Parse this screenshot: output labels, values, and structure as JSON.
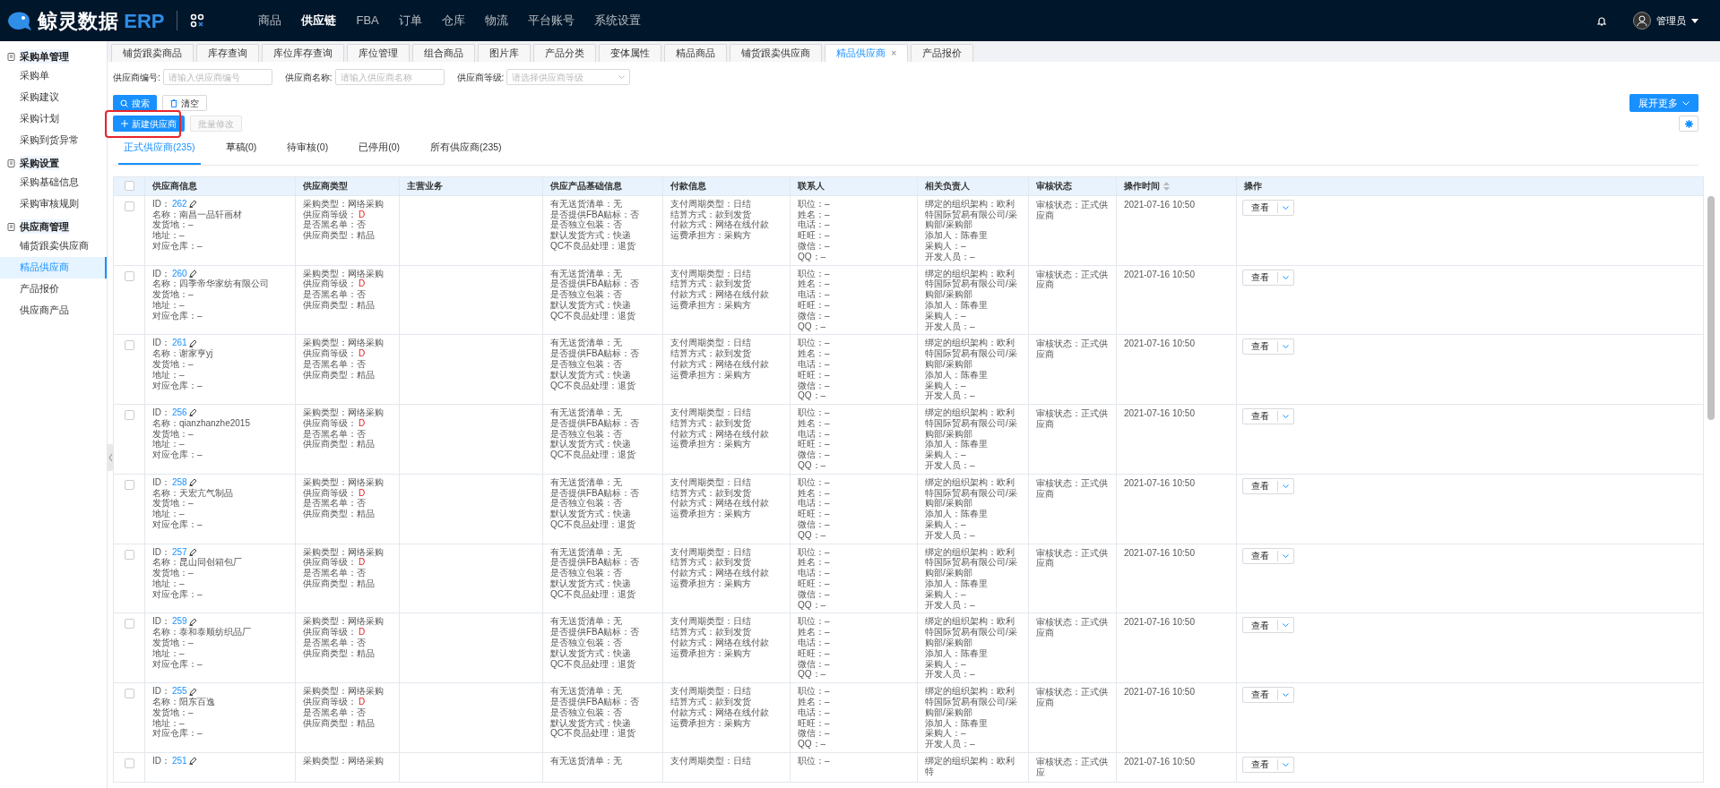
{
  "brand": {
    "name": "鲸灵数据",
    "suffix": "ERP"
  },
  "nav": [
    {
      "label": "商品",
      "selected": false
    },
    {
      "label": "供应链",
      "selected": true
    },
    {
      "label": "FBA",
      "selected": false
    },
    {
      "label": "订单",
      "selected": false
    },
    {
      "label": "仓库",
      "selected": false
    },
    {
      "label": "物流",
      "selected": false
    },
    {
      "label": "平台账号",
      "selected": false
    },
    {
      "label": "系统设置",
      "selected": false
    }
  ],
  "user": {
    "name": "管理员"
  },
  "sidebar": [
    {
      "label": "采购单管理",
      "children": [
        {
          "label": "采购单",
          "selected": false
        },
        {
          "label": "采购建议",
          "selected": false
        },
        {
          "label": "采购计划",
          "selected": false
        },
        {
          "label": "采购到货异常",
          "selected": false
        }
      ]
    },
    {
      "label": "采购设置",
      "children": [
        {
          "label": "采购基础信息",
          "selected": false
        },
        {
          "label": "采购审核规则",
          "selected": false
        }
      ]
    },
    {
      "label": "供应商管理",
      "children": [
        {
          "label": "铺货跟卖供应商",
          "selected": false
        },
        {
          "label": "精品供应商",
          "selected": true
        },
        {
          "label": "产品报价",
          "selected": false
        },
        {
          "label": "供应商产品",
          "selected": false
        }
      ]
    }
  ],
  "tabs": [
    {
      "label": "铺货跟卖商品",
      "selected": false
    },
    {
      "label": "库存查询",
      "selected": false
    },
    {
      "label": "库位库存查询",
      "selected": false
    },
    {
      "label": "库位管理",
      "selected": false
    },
    {
      "label": "组合商品",
      "selected": false
    },
    {
      "label": "图片库",
      "selected": false
    },
    {
      "label": "产品分类",
      "selected": false
    },
    {
      "label": "变体属性",
      "selected": false
    },
    {
      "label": "精品商品",
      "selected": false
    },
    {
      "label": "铺货跟卖供应商",
      "selected": false
    },
    {
      "label": "精品供应商",
      "selected": true,
      "close": "×"
    },
    {
      "label": "产品报价",
      "selected": false
    }
  ],
  "filters": [
    {
      "label": "供应商编号:",
      "placeholder": "请输入供应商编号",
      "kind": "input"
    },
    {
      "label": "供应商名称:",
      "placeholder": "请输入供应商名称",
      "kind": "input"
    },
    {
      "label": "供应商等级:",
      "placeholder": "请选择供应商等级",
      "kind": "select"
    }
  ],
  "search_button": "搜索",
  "clear_button": "清空",
  "expand_button": "展开更多",
  "new_button": "新建供应商",
  "batch_button": {
    "label": "批量修改",
    "disabled": true
  },
  "status_tabs": [
    {
      "label": "正式供应商(235)",
      "selected": true
    },
    {
      "label": "草稿(0)",
      "selected": false
    },
    {
      "label": "待审核(0)",
      "selected": false
    },
    {
      "label": "已停用(0)",
      "selected": false
    },
    {
      "label": "所有供应商(235)",
      "selected": false
    }
  ],
  "table": {
    "select_all_checked": false,
    "columns": [
      "供应商信息",
      "供应商类型",
      "主营业务",
      "供应产品基础信息",
      "付款信息",
      "联系人",
      "相关负责人",
      "审核状态",
      "操作时间",
      "操作"
    ],
    "rows": [
      {
        "checked": false,
        "supplier": [
          {
            "label": "ID：",
            "value": "262",
            "kind": "id"
          },
          "名称：南昌一品轩画材",
          "发货地：–",
          "地址：–",
          "对应仓库：–"
        ],
        "type": [
          "采购类型：网络采购",
          {
            "label": "供应商等级：",
            "value": "D",
            "kind": "grade"
          },
          "是否黑名单：否",
          "供应商类型：精品"
        ],
        "product": [
          "有无送货清单：无",
          "是否提供FBA贴标：否",
          "是否独立包装：否",
          "默认发货方式：快递",
          "QC不良品处理：退货"
        ],
        "payment": [
          "支付周期类型：日结",
          "结算方式：款到发货",
          "付款方式：网络在线付款",
          "运费承担方：采购方"
        ],
        "contact": [
          "职位：–",
          "姓名：–",
          "电话：–",
          "旺旺：–",
          "微信：–",
          "QQ：–"
        ],
        "owner": [
          "绑定的组织架构：欧利特国际贸易有限公司/采购部/采购部",
          "添加人：陈春里",
          "采购人：–",
          "开发人员：–"
        ],
        "review": "审核状态：正式供应商",
        "time": "2021-07-16 10:50",
        "action": "查看"
      },
      {
        "checked": false,
        "supplier": [
          {
            "label": "ID：",
            "value": "260",
            "kind": "id"
          },
          "名称：四季帝华家纺有限公司",
          "发货地：–",
          "地址：–",
          "对应仓库：–"
        ],
        "type": [
          "采购类型：网络采购",
          {
            "label": "供应商等级：",
            "value": "D",
            "kind": "grade"
          },
          "是否黑名单：否",
          "供应商类型：精品"
        ],
        "product": [
          "有无送货清单：无",
          "是否提供FBA贴标：否",
          "是否独立包装：否",
          "默认发货方式：快递",
          "QC不良品处理：退货"
        ],
        "payment": [
          "支付周期类型：日结",
          "结算方式：款到发货",
          "付款方式：网络在线付款",
          "运费承担方：采购方"
        ],
        "contact": [
          "职位：–",
          "姓名：–",
          "电话：–",
          "旺旺：–",
          "微信：–",
          "QQ：–"
        ],
        "owner": [
          "绑定的组织架构：欧利特国际贸易有限公司/采购部/采购部",
          "添加人：陈春里",
          "采购人：–",
          "开发人员：–"
        ],
        "review": "审核状态：正式供应商",
        "time": "2021-07-16 10:50",
        "action": "查看"
      },
      {
        "checked": false,
        "supplier": [
          {
            "label": "ID：",
            "value": "261",
            "kind": "id"
          },
          "名称：谢家亨yj",
          "发货地：–",
          "地址：–",
          "对应仓库：–"
        ],
        "type": [
          "采购类型：网络采购",
          {
            "label": "供应商等级：",
            "value": "D",
            "kind": "grade"
          },
          "是否黑名单：否",
          "供应商类型：精品"
        ],
        "product": [
          "有无送货清单：无",
          "是否提供FBA贴标：否",
          "是否独立包装：否",
          "默认发货方式：快递",
          "QC不良品处理：退货"
        ],
        "payment": [
          "支付周期类型：日结",
          "结算方式：款到发货",
          "付款方式：网络在线付款",
          "运费承担方：采购方"
        ],
        "contact": [
          "职位：–",
          "姓名：–",
          "电话：–",
          "旺旺：–",
          "微信：–",
          "QQ：–"
        ],
        "owner": [
          "绑定的组织架构：欧利特国际贸易有限公司/采购部/采购部",
          "添加人：陈春里",
          "采购人：–",
          "开发人员：–"
        ],
        "review": "审核状态：正式供应商",
        "time": "2021-07-16 10:50",
        "action": "查看"
      },
      {
        "checked": false,
        "supplier": [
          {
            "label": "ID：",
            "value": "256",
            "kind": "id"
          },
          "名称：qianzhanzhe2015",
          "发货地：–",
          "地址：–",
          "对应仓库：–"
        ],
        "type": [
          "采购类型：网络采购",
          {
            "label": "供应商等级：",
            "value": "D",
            "kind": "grade"
          },
          "是否黑名单：否",
          "供应商类型：精品"
        ],
        "product": [
          "有无送货清单：无",
          "是否提供FBA贴标：否",
          "是否独立包装：否",
          "默认发货方式：快递",
          "QC不良品处理：退货"
        ],
        "payment": [
          "支付周期类型：日结",
          "结算方式：款到发货",
          "付款方式：网络在线付款",
          "运费承担方：采购方"
        ],
        "contact": [
          "职位：–",
          "姓名：–",
          "电话：–",
          "旺旺：–",
          "微信：–",
          "QQ：–"
        ],
        "owner": [
          "绑定的组织架构：欧利特国际贸易有限公司/采购部/采购部",
          "添加人：陈春里",
          "采购人：–",
          "开发人员：–"
        ],
        "review": "审核状态：正式供应商",
        "time": "2021-07-16 10:50",
        "action": "查看"
      },
      {
        "checked": false,
        "supplier": [
          {
            "label": "ID：",
            "value": "258",
            "kind": "id"
          },
          "名称：天宏亢气制品",
          "发货地：–",
          "地址：–",
          "对应仓库：–"
        ],
        "type": [
          "采购类型：网络采购",
          {
            "label": "供应商等级：",
            "value": "D",
            "kind": "grade"
          },
          "是否黑名单：否",
          "供应商类型：精品"
        ],
        "product": [
          "有无送货清单：无",
          "是否提供FBA贴标：否",
          "是否独立包装：否",
          "默认发货方式：快递",
          "QC不良品处理：退货"
        ],
        "payment": [
          "支付周期类型：日结",
          "结算方式：款到发货",
          "付款方式：网络在线付款",
          "运费承担方：采购方"
        ],
        "contact": [
          "职位：–",
          "姓名：–",
          "电话：–",
          "旺旺：–",
          "微信：–",
          "QQ：–"
        ],
        "owner": [
          "绑定的组织架构：欧利特国际贸易有限公司/采购部/采购部",
          "添加人：陈春里",
          "采购人：–",
          "开发人员：–"
        ],
        "review": "审核状态：正式供应商",
        "time": "2021-07-16 10:50",
        "action": "查看"
      },
      {
        "checked": false,
        "supplier": [
          {
            "label": "ID：",
            "value": "257",
            "kind": "id"
          },
          "名称：昆山同创箱包厂",
          "发货地：–",
          "地址：–",
          "对应仓库：–"
        ],
        "type": [
          "采购类型：网络采购",
          {
            "label": "供应商等级：",
            "value": "D",
            "kind": "grade"
          },
          "是否黑名单：否",
          "供应商类型：精品"
        ],
        "product": [
          "有无送货清单：无",
          "是否提供FBA贴标：否",
          "是否独立包装：否",
          "默认发货方式：快递",
          "QC不良品处理：退货"
        ],
        "payment": [
          "支付周期类型：日结",
          "结算方式：款到发货",
          "付款方式：网络在线付款",
          "运费承担方：采购方"
        ],
        "contact": [
          "职位：–",
          "姓名：–",
          "电话：–",
          "旺旺：–",
          "微信：–",
          "QQ：–"
        ],
        "owner": [
          "绑定的组织架构：欧利特国际贸易有限公司/采购部/采购部",
          "添加人：陈春里",
          "采购人：–",
          "开发人员：–"
        ],
        "review": "审核状态：正式供应商",
        "time": "2021-07-16 10:50",
        "action": "查看"
      },
      {
        "checked": false,
        "supplier": [
          {
            "label": "ID：",
            "value": "259",
            "kind": "id"
          },
          "名称：泰和泰顺纺织品厂",
          "发货地：–",
          "地址：–",
          "对应仓库：–"
        ],
        "type": [
          "采购类型：网络采购",
          {
            "label": "供应商等级：",
            "value": "D",
            "kind": "grade"
          },
          "是否黑名单：否",
          "供应商类型：精品"
        ],
        "product": [
          "有无送货清单：无",
          "是否提供FBA贴标：否",
          "是否独立包装：否",
          "默认发货方式：快递",
          "QC不良品处理：退货"
        ],
        "payment": [
          "支付周期类型：日结",
          "结算方式：款到发货",
          "付款方式：网络在线付款",
          "运费承担方：采购方"
        ],
        "contact": [
          "职位：–",
          "姓名：–",
          "电话：–",
          "旺旺：–",
          "微信：–",
          "QQ：–"
        ],
        "owner": [
          "绑定的组织架构：欧利特国际贸易有限公司/采购部/采购部",
          "添加人：陈春里",
          "采购人：–",
          "开发人员：–"
        ],
        "review": "审核状态：正式供应商",
        "time": "2021-07-16 10:50",
        "action": "查看"
      },
      {
        "checked": false,
        "supplier": [
          {
            "label": "ID：",
            "value": "255",
            "kind": "id"
          },
          "名称：阳东百逸",
          "发货地：–",
          "地址：–",
          "对应仓库：–"
        ],
        "type": [
          "采购类型：网络采购",
          {
            "label": "供应商等级：",
            "value": "D",
            "kind": "grade"
          },
          "是否黑名单：否",
          "供应商类型：精品"
        ],
        "product": [
          "有无送货清单：无",
          "是否提供FBA贴标：否",
          "是否独立包装：否",
          "默认发货方式：快递",
          "QC不良品处理：退货"
        ],
        "payment": [
          "支付周期类型：日结",
          "结算方式：款到发货",
          "付款方式：网络在线付款",
          "运费承担方：采购方"
        ],
        "contact": [
          "职位：–",
          "姓名：–",
          "电话：–",
          "旺旺：–",
          "微信：–",
          "QQ：–"
        ],
        "owner": [
          "绑定的组织架构：欧利特国际贸易有限公司/采购部/采购部",
          "添加人：陈春里",
          "采购人：–",
          "开发人员：–"
        ],
        "review": "审核状态：正式供应商",
        "time": "2021-07-16 10:50",
        "action": "查看"
      },
      {
        "checked": false,
        "supplier": [
          {
            "label": "ID：",
            "value": "251",
            "kind": "id"
          }
        ],
        "type": [
          "采购类型：网络采购"
        ],
        "product": [
          "有无送货清单：无"
        ],
        "payment": [
          "支付周期类型：日结"
        ],
        "contact": [
          "职位：–"
        ],
        "owner": [
          "绑定的组织架构：欧利特"
        ],
        "review": "审核状态：正式供应",
        "time": "2021-07-16 10:50",
        "action": "查看"
      }
    ]
  }
}
